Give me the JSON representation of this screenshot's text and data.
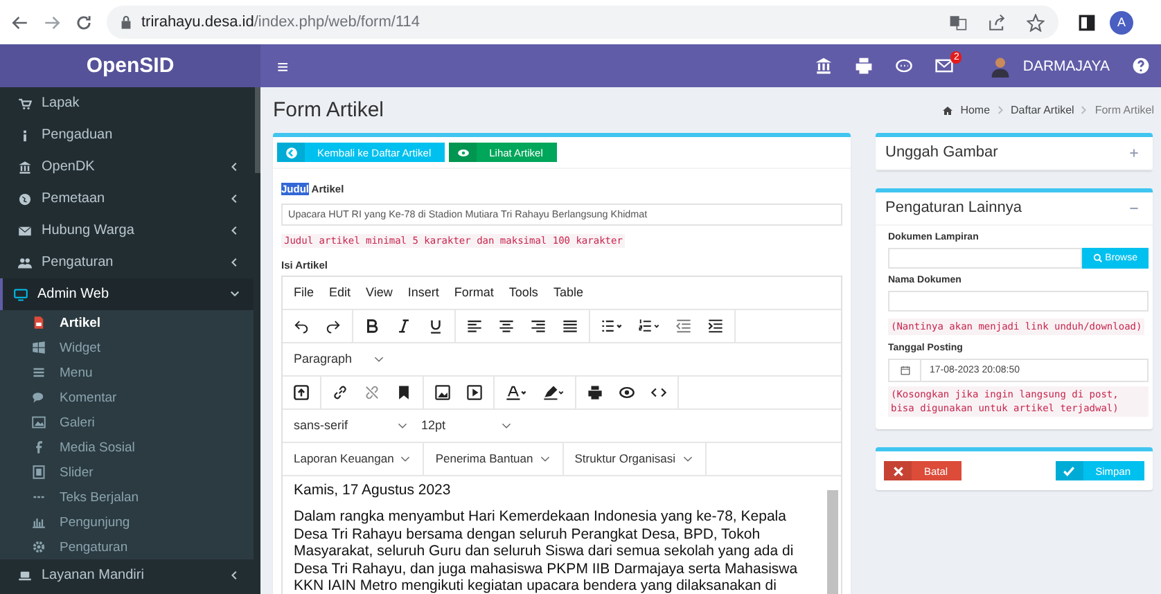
{
  "browser": {
    "url_host": "trirahayu.desa.id",
    "url_path": "/index.php/web/form/114",
    "profile_initial": "A"
  },
  "header": {
    "brand": "OpenSID",
    "menu_glyph": "≡",
    "notification_count": "2",
    "user": "DARMAJAYA"
  },
  "sidebar": {
    "items": [
      {
        "label": "Lapak",
        "selected": false
      },
      {
        "label": "Pengaduan",
        "selected": false
      },
      {
        "label": "OpenDK",
        "expanded": false,
        "selected": false
      },
      {
        "label": "Pemetaan",
        "expanded": false,
        "selected": false
      },
      {
        "label": "Hubung Warga",
        "expanded": false,
        "selected": false
      },
      {
        "label": "Pengaturan",
        "expanded": false,
        "selected": false
      },
      {
        "label": "Admin Web",
        "expanded": true,
        "selected": true,
        "children": [
          {
            "label": "Artikel",
            "selected": true
          },
          {
            "label": "Widget",
            "selected": false
          },
          {
            "label": "Menu",
            "selected": false
          },
          {
            "label": "Komentar",
            "selected": false
          },
          {
            "label": "Galeri",
            "selected": false
          },
          {
            "label": "Media Sosial",
            "selected": false
          },
          {
            "label": "Slider",
            "selected": false
          },
          {
            "label": "Teks Berjalan",
            "selected": false
          },
          {
            "label": "Pengunjung",
            "selected": false
          },
          {
            "label": "Pengaturan",
            "selected": false
          }
        ]
      },
      {
        "label": "Layanan Mandiri",
        "expanded": false,
        "selected": false
      }
    ]
  },
  "page": {
    "title": "Form Artikel",
    "breadcrumb": [
      "Home",
      "Daftar Artikel",
      "Form Artikel"
    ]
  },
  "form": {
    "buttons": [
      {
        "label": "Kembali ke Daftar Artikel",
        "kind": "back"
      },
      {
        "label": "Lihat Artikel",
        "kind": "view"
      }
    ],
    "title_label": {
      "selected_part": "Judul",
      "rest": "Artikel"
    },
    "title_value": "Upacara HUT RI yang Ke-78 di Stadion Mutiara Tri Rahayu Berlangsung Khidmat",
    "title_hint": "Judul artikel minimal 5 karakter dan maksimal 100 karakter",
    "content_label": "Isi Artikel",
    "editor": {
      "menubar": [
        "File",
        "Edit",
        "View",
        "Insert",
        "Format",
        "Tools",
        "Table"
      ],
      "block_format": "Paragraph",
      "font_family": "sans-serif",
      "font_size": "12pt",
      "custom_menus": [
        "Laporan Keuangan",
        "Penerima Bantuan",
        "Struktur Organisasi"
      ],
      "content": [
        "Kamis, 17 Agustus 2023",
        "Dalam rangka menyambut Hari Kemerdekaan Indonesia yang ke-78, Kepala Desa Tri Rahayu bersama dengan seluruh Perangkat Desa, BPD, Tokoh Masyarakat, seluruh Guru dan seluruh Siswa dari semua sekolah yang ada di Desa Tri Rahayu, dan juga mahasiswa PKPM IIB Darmajaya serta Mahasiswa KKN IAIN Metro mengikuti kegiatan upacara bendera yang dilaksanakan di"
      ]
    }
  },
  "image_box": {
    "title": "Unggah Gambar",
    "expanded": false
  },
  "settings_box": {
    "title": "Pengaturan Lainnya",
    "expanded": true,
    "attachment_label": "Dokumen Lampiran",
    "browse_button": "Browse",
    "doc_name_label": "Nama Dokumen",
    "doc_name_hint": "(Nantinya akan menjadi link unduh/download)",
    "date_label": "Tanggal Posting",
    "date_value": "17-08-2023 20:08:50",
    "date_hint": "(Kosongkan jika ingin langsung di post, bisa digunakan untuk artikel terjadwal)"
  },
  "actions": [
    {
      "label": "Batal",
      "kind": "cancel"
    },
    {
      "label": "Simpan",
      "kind": "save"
    }
  ]
}
